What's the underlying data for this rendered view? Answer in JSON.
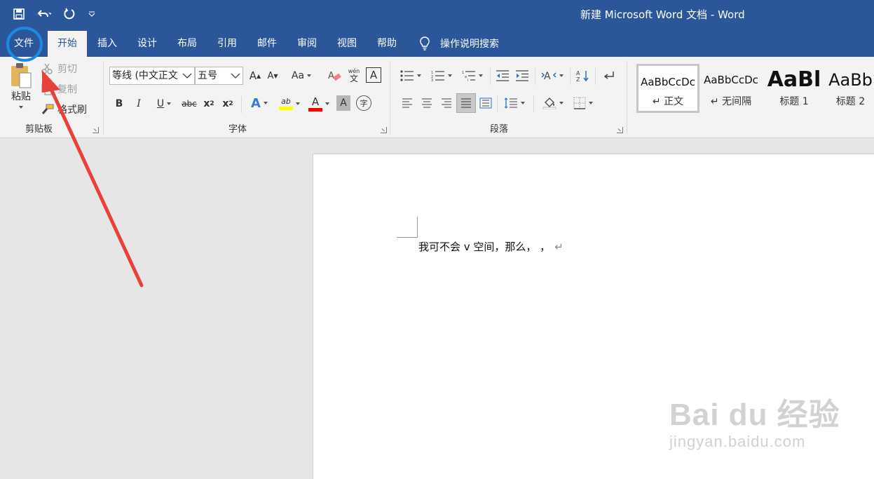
{
  "window": {
    "title": "新建 Microsoft Word 文档 - Word"
  },
  "tabs": [
    {
      "label": "文件"
    },
    {
      "label": "开始"
    },
    {
      "label": "插入"
    },
    {
      "label": "设计"
    },
    {
      "label": "布局"
    },
    {
      "label": "引用"
    },
    {
      "label": "邮件"
    },
    {
      "label": "审阅"
    },
    {
      "label": "视图"
    },
    {
      "label": "帮助"
    }
  ],
  "tell_me": {
    "label": "操作说明搜索"
  },
  "clipboard": {
    "group_label": "剪贴板",
    "paste": "粘贴",
    "cut": "剪切",
    "copy": "复制",
    "format_painter": "格式刷"
  },
  "font": {
    "group_label": "字体",
    "font_name": "等线 (中文正文",
    "font_size": "五号",
    "grow_glyph": "A",
    "shrink_glyph": "A",
    "case_glyph": "Aa",
    "phonetic_top": "wén",
    "phonetic_bottom": "文",
    "border_glyph": "A",
    "bold": "B",
    "italic": "I",
    "underline": "U",
    "strike": "abc",
    "sub": "x",
    "sub_mark": "2",
    "sup": "x",
    "sup_mark": "2",
    "effects_glyph": "A",
    "highlight_glyph": "ab",
    "color_glyph": "A",
    "shade_glyph": "A",
    "enclose_glyph": "字",
    "highlight_color": "#ffff00",
    "font_color": "#ff0000"
  },
  "paragraph": {
    "group_label": "段落"
  },
  "styles": {
    "items": [
      {
        "sample": "AaBbCcDc",
        "name": "↵ 正文"
      },
      {
        "sample": "AaBbCcDc",
        "name": "↵ 无间隔"
      },
      {
        "sample": "AaBl",
        "name": "标题 1"
      },
      {
        "sample": "AaBb",
        "name": "标题 2"
      }
    ]
  },
  "document": {
    "text": "我可不会 v 空间，那么，  ，",
    "para_mark": "↵"
  },
  "watermark": {
    "brand": "Bai du 经验",
    "url": "jingyan.baidu.com"
  },
  "colors": {
    "accent": "#2b579a",
    "annotation": "#e8413b",
    "circle": "#1e88e5"
  }
}
